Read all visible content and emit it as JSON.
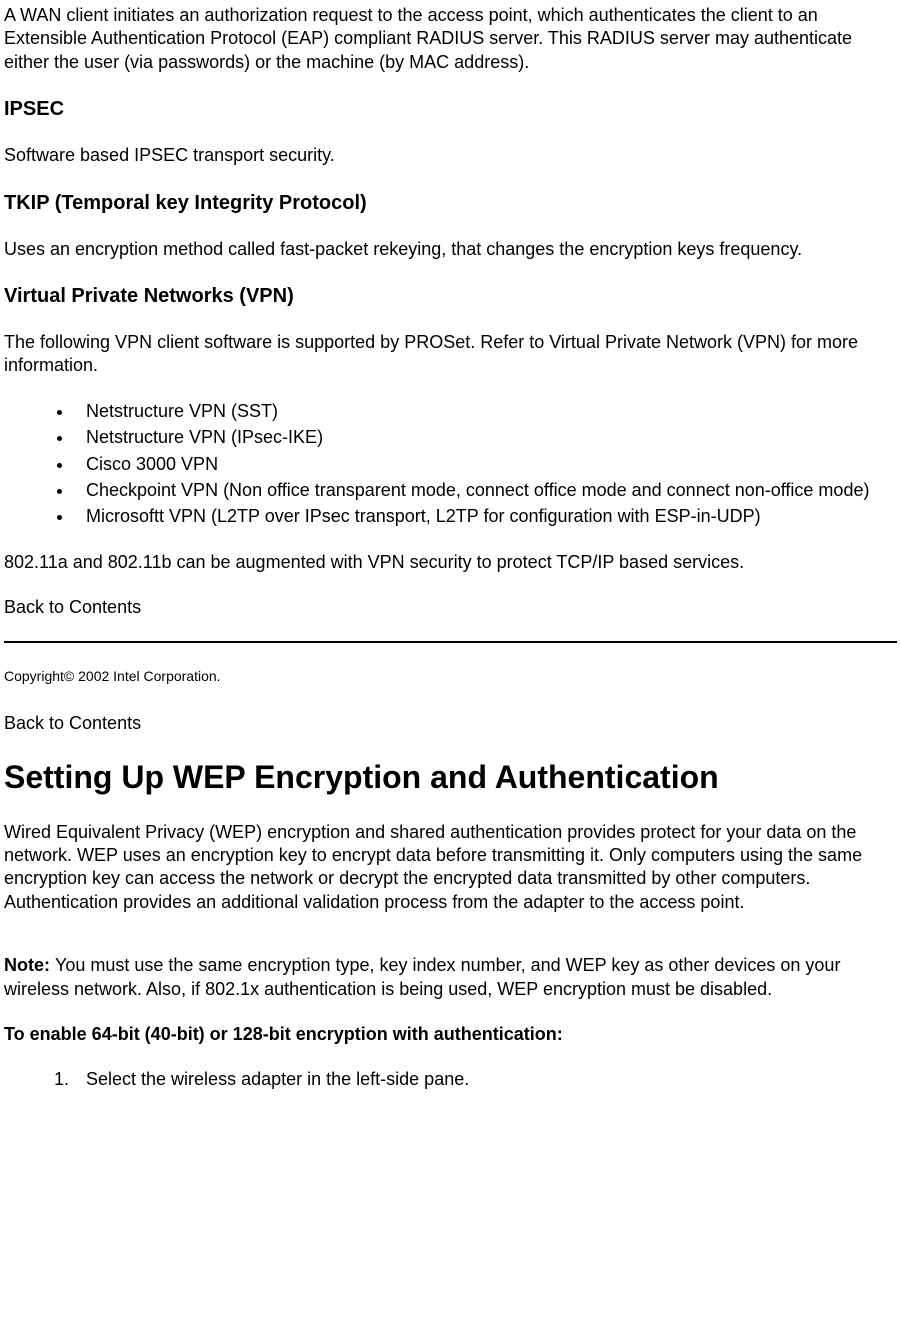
{
  "intro_p": "A WAN client initiates an authorization request to the access point, which authenticates the client to an Extensible Authentication Protocol (EAP) compliant RADIUS server. This RADIUS server may authenticate either the user (via passwords) or the machine (by MAC address).",
  "ipsec": {
    "heading": "IPSEC",
    "body": "Software based IPSEC transport security."
  },
  "tkip": {
    "heading": "TKIP (Temporal key Integrity Protocol)",
    "body": "Uses an encryption method called fast-packet rekeying, that changes the encryption keys frequency."
  },
  "vpn": {
    "heading": "Virtual Private Networks (VPN)",
    "intro": "The following VPN client software is supported by PROSet. Refer to Virtual Private Network (VPN) for more information.",
    "items": [
      "Netstructure VPN (SST)",
      "Netstructure VPN (IPsec-IKE)",
      "Cisco 3000 VPN",
      "Checkpoint VPN (Non office transparent mode, connect office mode and connect non-office mode)",
      "Microsoftt VPN (L2TP over IPsec transport, L2TP for configuration with ESP-in-UDP)"
    ],
    "outro": "802.11a and 802.11b can be augmented with VPN security to protect TCP/IP based services."
  },
  "links": {
    "back1": "Back to Contents",
    "back2": "Back to Contents"
  },
  "copyright": "Copyright© 2002 Intel Corporation.",
  "wep": {
    "title": "Setting Up WEP Encryption and Authentication",
    "p1": "Wired Equivalent Privacy (WEP) encryption and shared authentication provides protect for your data on the network. WEP uses an encryption key to encrypt data before transmitting it. Only computers using the same encryption key can access the network or decrypt the encrypted data transmitted by other computers. Authentication provides an additional validation process from the adapter to the access point.",
    "note_label": "Note: ",
    "note_body": "You must use the same encryption type, key index number, and WEP key as other devices on your wireless network. Also, if 802.1x authentication is being used, WEP encryption must be disabled.",
    "enable_heading": "To enable 64-bit (40-bit) or 128-bit encryption with authentication:",
    "steps": [
      "Select the wireless adapter in the left-side pane."
    ]
  }
}
